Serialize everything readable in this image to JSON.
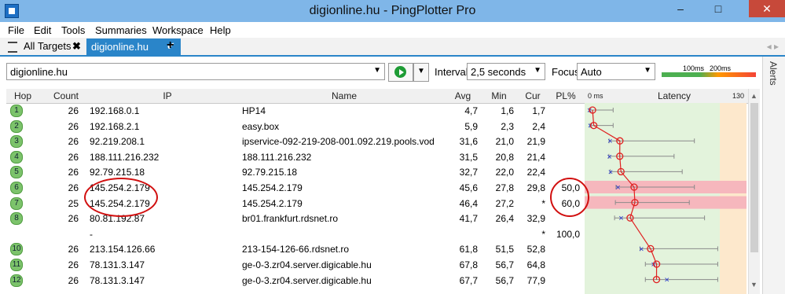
{
  "window": {
    "title": "digionline.hu - PingPlotter Pro",
    "min_label": "–",
    "max_label": "□",
    "close_label": "✕"
  },
  "menu": {
    "items": [
      "File",
      "Edit",
      "Tools",
      "Summaries",
      "Workspace",
      "Help"
    ]
  },
  "tabs": {
    "all_targets": "All Targets",
    "active": "digionline.hu",
    "add": "+",
    "nav": "◂ ▸"
  },
  "toolbar": {
    "target_value": "digionline.hu",
    "interval_label": "Interval",
    "interval_value": "2,5 seconds",
    "focus_label": "Focus",
    "focus_value": "Auto",
    "scale_100": "100ms",
    "scale_200": "200ms"
  },
  "columns": {
    "hop": "Hop",
    "count": "Count",
    "ip": "IP",
    "name": "Name",
    "avg": "Avg",
    "min": "Min",
    "cur": "Cur",
    "pl": "PL%",
    "latency": "Latency",
    "latency_min": "0 ms",
    "latency_max": "130"
  },
  "sidebar": {
    "alerts": "Alerts"
  },
  "rows": [
    {
      "hop": "1",
      "count": "26",
      "ip": "192.168.0.1",
      "name": "HP14",
      "avg": "4,7",
      "min": "1,6",
      "cur": "1,7",
      "pl": ""
    },
    {
      "hop": "2",
      "count": "26",
      "ip": "192.168.2.1",
      "name": "easy.box",
      "avg": "5,9",
      "min": "2,3",
      "cur": "2,4",
      "pl": ""
    },
    {
      "hop": "3",
      "count": "26",
      "ip": "92.219.208.1",
      "name": "ipservice-092-219-208-001.092.219.pools.vod",
      "avg": "31,6",
      "min": "21,0",
      "cur": "21,9",
      "pl": ""
    },
    {
      "hop": "4",
      "count": "26",
      "ip": "188.111.216.232",
      "name": "188.111.216.232",
      "avg": "31,5",
      "min": "20,8",
      "cur": "21,4",
      "pl": ""
    },
    {
      "hop": "5",
      "count": "26",
      "ip": "92.79.215.18",
      "name": "92.79.215.18",
      "avg": "32,7",
      "min": "22,0",
      "cur": "22,4",
      "pl": ""
    },
    {
      "hop": "6",
      "count": "26",
      "ip": "145.254.2.179",
      "name": "145.254.2.179",
      "avg": "45,6",
      "min": "27,8",
      "cur": "29,8",
      "pl": "50,0"
    },
    {
      "hop": "7",
      "count": "25",
      "ip": "145.254.2.179",
      "name": "145.254.2.179",
      "avg": "46,4",
      "min": "27,2",
      "cur": "*",
      "pl": "60,0"
    },
    {
      "hop": "8",
      "count": "26",
      "ip": "80.81.192.87",
      "name": "br01.frankfurt.rdsnet.ro",
      "avg": "41,7",
      "min": "26,4",
      "cur": "32,9",
      "pl": ""
    },
    {
      "hop": "",
      "count": "",
      "ip": "-",
      "name": "",
      "avg": "",
      "min": "",
      "cur": "*",
      "pl": "100,0"
    },
    {
      "hop": "10",
      "count": "26",
      "ip": "213.154.126.66",
      "name": "213-154-126-66.rdsnet.ro",
      "avg": "61,8",
      "min": "51,5",
      "cur": "52,8",
      "pl": ""
    },
    {
      "hop": "11",
      "count": "26",
      "ip": "78.131.3.147",
      "name": "ge-0-3.zr04.server.digicable.hu",
      "avg": "67,8",
      "min": "56,7",
      "cur": "64,8",
      "pl": ""
    },
    {
      "hop": "12",
      "count": "26",
      "ip": "78.131.3.147",
      "name": "ge-0-3.zr04.server.digicable.hu",
      "avg": "67,7",
      "min": "56,7",
      "cur": "77,9",
      "pl": ""
    }
  ],
  "chart_data": {
    "type": "scatter",
    "xlim": [
      0,
      130
    ],
    "hops": [
      {
        "avg": 4.7,
        "min": 1.6,
        "cur": 1.7,
        "max": 25,
        "pl": 0
      },
      {
        "avg": 5.9,
        "min": 2.3,
        "cur": 2.4,
        "max": 25,
        "pl": 0
      },
      {
        "avg": 31.6,
        "min": 21.0,
        "cur": 21.9,
        "max": 105,
        "pl": 0
      },
      {
        "avg": 31.5,
        "min": 20.8,
        "cur": 21.4,
        "max": 85,
        "pl": 0
      },
      {
        "avg": 32.7,
        "min": 22.0,
        "cur": 22.4,
        "max": 93,
        "pl": 0
      },
      {
        "avg": 45.6,
        "min": 27.8,
        "cur": 29.8,
        "max": 105,
        "pl": 50.0
      },
      {
        "avg": 46.4,
        "min": 27.2,
        "cur": null,
        "max": 100,
        "pl": 60.0
      },
      {
        "avg": 41.7,
        "min": 26.4,
        "cur": 32.9,
        "max": 115,
        "pl": 0
      },
      null,
      {
        "avg": 61.8,
        "min": 51.5,
        "cur": 52.8,
        "max": 128,
        "pl": 0
      },
      {
        "avg": 67.8,
        "min": 56.7,
        "cur": 64.8,
        "max": 128,
        "pl": 0
      },
      {
        "avg": 67.7,
        "min": 56.7,
        "cur": 77.9,
        "max": 128,
        "pl": 0
      }
    ]
  }
}
